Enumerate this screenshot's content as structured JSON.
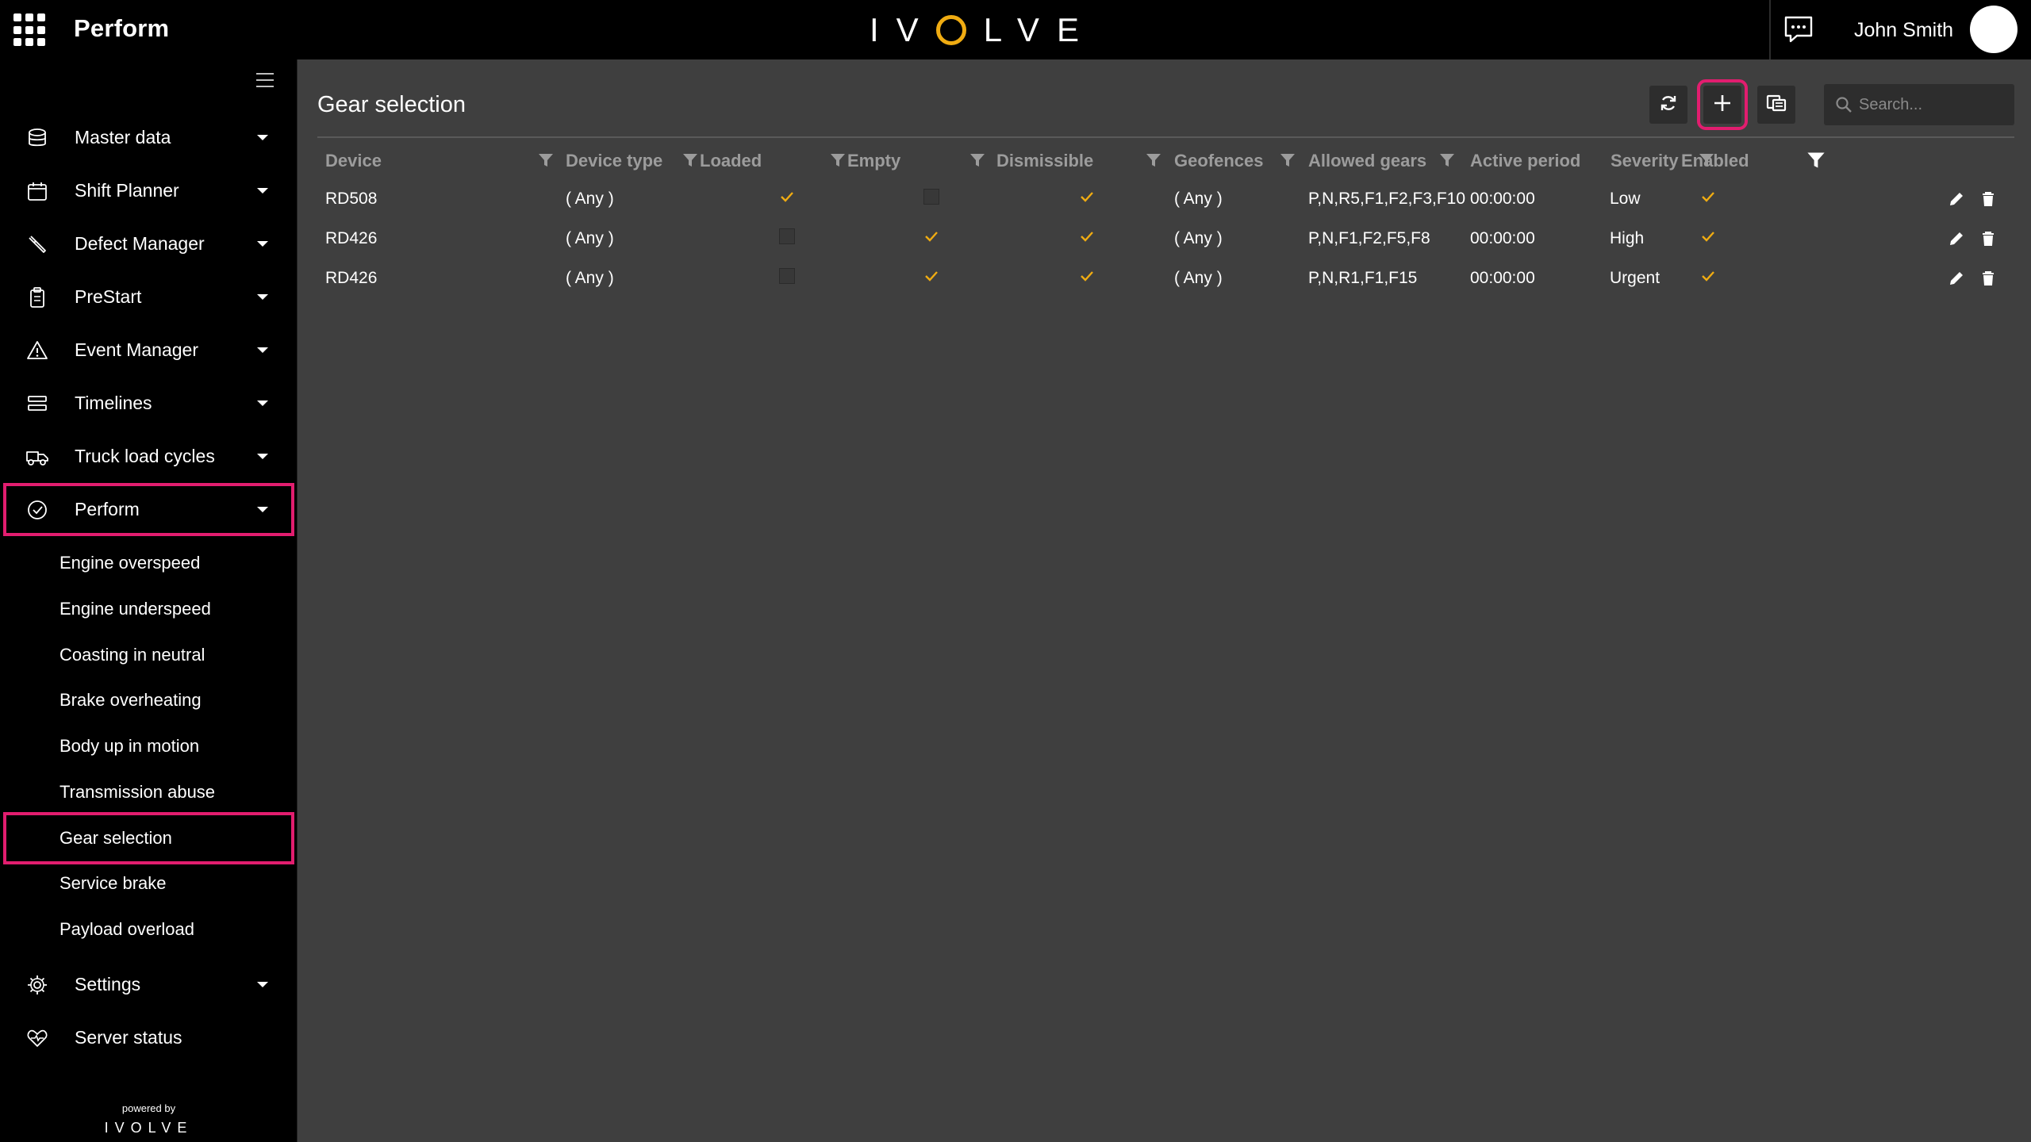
{
  "app": {
    "title": "Perform",
    "brand": "IVOLVE",
    "brand_parts": [
      "IV",
      "LVE"
    ]
  },
  "user": {
    "name": "John Smith"
  },
  "sidebar": {
    "items": [
      {
        "label": "Master data",
        "icon": "database-icon"
      },
      {
        "label": "Shift Planner",
        "icon": "calendar-icon"
      },
      {
        "label": "Defect Manager",
        "icon": "wrench-icon"
      },
      {
        "label": "PreStart",
        "icon": "clipboard-icon"
      },
      {
        "label": "Event Manager",
        "icon": "warning-icon"
      },
      {
        "label": "Timelines",
        "icon": "timeline-icon"
      },
      {
        "label": "Truck load cycles",
        "icon": "truck-icon"
      },
      {
        "label": "Perform",
        "icon": "check-circle-icon",
        "active": true
      }
    ],
    "sub_items": [
      "Engine overspeed",
      "Engine underspeed",
      "Coasting in neutral",
      "Brake overheating",
      "Body up in motion",
      "Transmission abuse",
      "Gear selection",
      "Service brake",
      "Payload overload"
    ],
    "active_sub_item": "Gear selection",
    "bottom_items": [
      {
        "label": "Settings",
        "icon": "gear-icon"
      },
      {
        "label": "Server status",
        "icon": "heart-pulse-icon"
      }
    ],
    "footer": {
      "powered_by": "powered by",
      "logo": "IVOLVE"
    }
  },
  "main": {
    "title": "Gear selection",
    "search": {
      "placeholder": "Search..."
    },
    "toolbar": [
      "refresh-icon",
      "plus-icon",
      "export-icon"
    ],
    "colors": {
      "accent": "#f0ac12",
      "highlight": "#e21d6f"
    },
    "table": {
      "columns": [
        "Device",
        "Device type",
        "Loaded",
        "Empty",
        "Dismissible",
        "Geofences",
        "Allowed gears",
        "Active period",
        "Severity",
        "Enabled"
      ],
      "rows": [
        {
          "device": "RD508",
          "device_type": "( Any )",
          "loaded": true,
          "empty": false,
          "dismissible": true,
          "geofences": "( Any )",
          "allowed_gears": "P,N,R5,F1,F2,F3,F10",
          "active_period": "00:00:00",
          "severity": "Low",
          "enabled": true
        },
        {
          "device": "RD426",
          "device_type": "( Any )",
          "loaded": false,
          "empty": true,
          "dismissible": true,
          "geofences": "( Any )",
          "allowed_gears": "P,N,F1,F2,F5,F8",
          "active_period": "00:00:00",
          "severity": "High",
          "enabled": true
        },
        {
          "device": "RD426",
          "device_type": "( Any )",
          "loaded": false,
          "empty": true,
          "dismissible": true,
          "geofences": "( Any )",
          "allowed_gears": "P,N,R1,F1,F15",
          "active_period": "00:00:00",
          "severity": "Urgent",
          "enabled": true
        }
      ]
    }
  }
}
